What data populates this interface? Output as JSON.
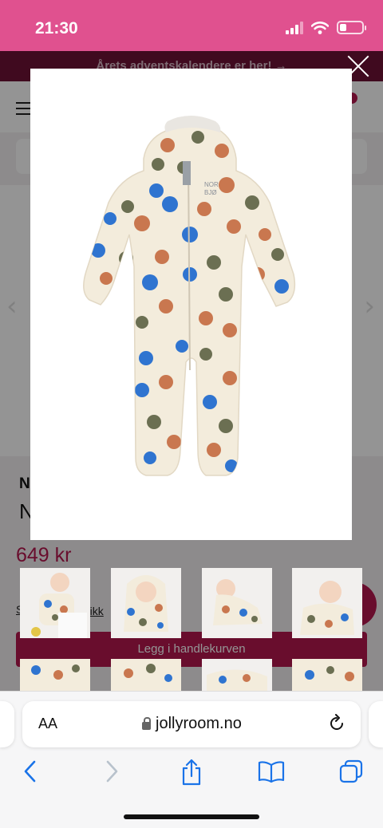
{
  "status_bar": {
    "time": "21:30",
    "battery_percent": 30
  },
  "promo": {
    "text": "Årets adventskalendere er her! →"
  },
  "product": {
    "brand_partial": "N",
    "title_partial": "N",
    "price": "649 kr",
    "size_guide": "S",
    "size_guide_tail": "rikk",
    "add_to_cart": "Legg i handlekurven"
  },
  "modal": {
    "image_name": "Printed baby rain overall",
    "logo_text_1": "NOR",
    "logo_text_2": "BJØ"
  },
  "thumbnails": [
    {
      "name": "thumbnail-1"
    },
    {
      "name": "thumbnail-2"
    },
    {
      "name": "thumbnail-3"
    },
    {
      "name": "thumbnail-4"
    },
    {
      "name": "thumbnail-5"
    },
    {
      "name": "thumbnail-6"
    },
    {
      "name": "thumbnail-7"
    },
    {
      "name": "thumbnail-8"
    }
  ],
  "browser": {
    "aa_label": "AA",
    "url": "jollyroom.no"
  },
  "colors": {
    "brand": "#b5174f",
    "status_bar": "#e0518f",
    "promo_bg": "#6f1236",
    "suit": "#f3ecdc",
    "dot_blue": "#2f74d0",
    "dot_orange": "#c9774f",
    "dot_green": "#6b6f52",
    "ios_blue": "#1a73e8"
  }
}
